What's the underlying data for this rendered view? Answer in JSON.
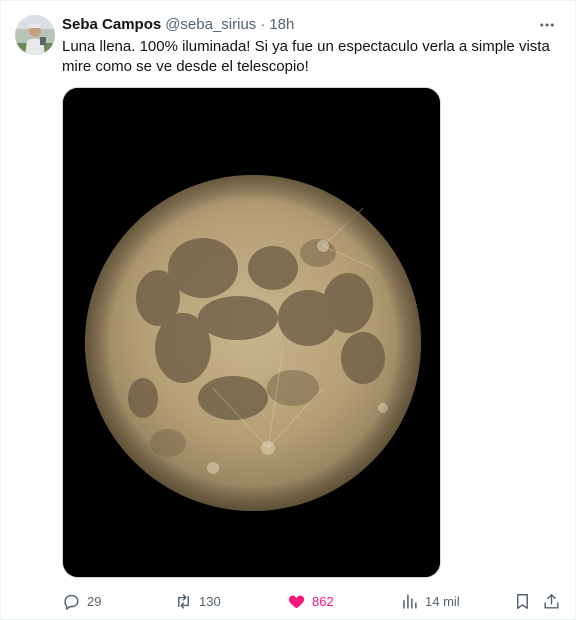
{
  "author": {
    "name": "Seba Campos",
    "handle": "@seba_sirius",
    "separator": "·",
    "time": "18h"
  },
  "tweet": {
    "text": "Luna llena. 100% iluminada! Si ya fue un espectaculo verla a simple vista mire como se ve desde el telescopio!"
  },
  "media": {
    "alt": "full-moon-photo"
  },
  "stats": {
    "replies": "29",
    "retweets": "130",
    "likes": "862",
    "views": "14 mil"
  },
  "icons": {
    "more": "more-horizontal-icon",
    "reply": "reply-icon",
    "retweet": "retweet-icon",
    "like": "heart-icon",
    "views": "views-chart-icon",
    "bookmark": "bookmark-icon",
    "share": "share-icon"
  },
  "colors": {
    "text_primary": "#0f1419",
    "text_secondary": "#536471",
    "like_active": "#f91880",
    "border": "#eff3f4"
  }
}
